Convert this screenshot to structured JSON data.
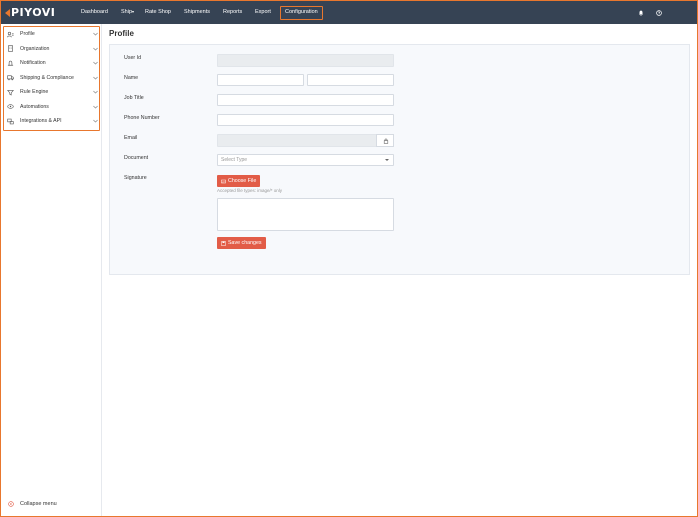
{
  "app": {
    "logo": "PIYOVI"
  },
  "nav": {
    "items": [
      {
        "label": "Dashboard"
      },
      {
        "label": "Ship"
      },
      {
        "label": "Rate Shop"
      },
      {
        "label": "Shipments"
      },
      {
        "label": "Reports"
      },
      {
        "label": "Export"
      },
      {
        "label": "Configuration",
        "active": true
      }
    ],
    "ship_caret": "▾",
    "icons": [
      "bell-icon",
      "help-icon"
    ]
  },
  "sidebar": {
    "items": [
      {
        "label": "Profile",
        "icon": "profile-icon"
      },
      {
        "label": "Organization",
        "icon": "organization-icon"
      },
      {
        "label": "Notification",
        "icon": "notification-icon"
      },
      {
        "label": "Shipping & Compliance",
        "icon": "truck-icon"
      },
      {
        "label": "Rule Engine",
        "icon": "filter-icon"
      },
      {
        "label": "Automations",
        "icon": "automation-icon"
      },
      {
        "label": "Integrations & API",
        "icon": "integration-icon"
      }
    ],
    "collapse_label": "Collapse menu"
  },
  "main": {
    "title": "Profile",
    "form": {
      "user_id_label": "User Id",
      "name_label": "Name",
      "job_title_label": "Job Title",
      "phone_label": "Phone Number",
      "email_label": "Email",
      "document_label": "Document",
      "document_placeholder": "Select Type",
      "signature_label": "Signature",
      "choose_file_label": "Choose File",
      "file_hint": "Accepted file types: image/* only",
      "save_label": "Save changes"
    }
  },
  "colors": {
    "navbar": "#364354",
    "accent": "#e8772e",
    "button": "#e25c47"
  }
}
